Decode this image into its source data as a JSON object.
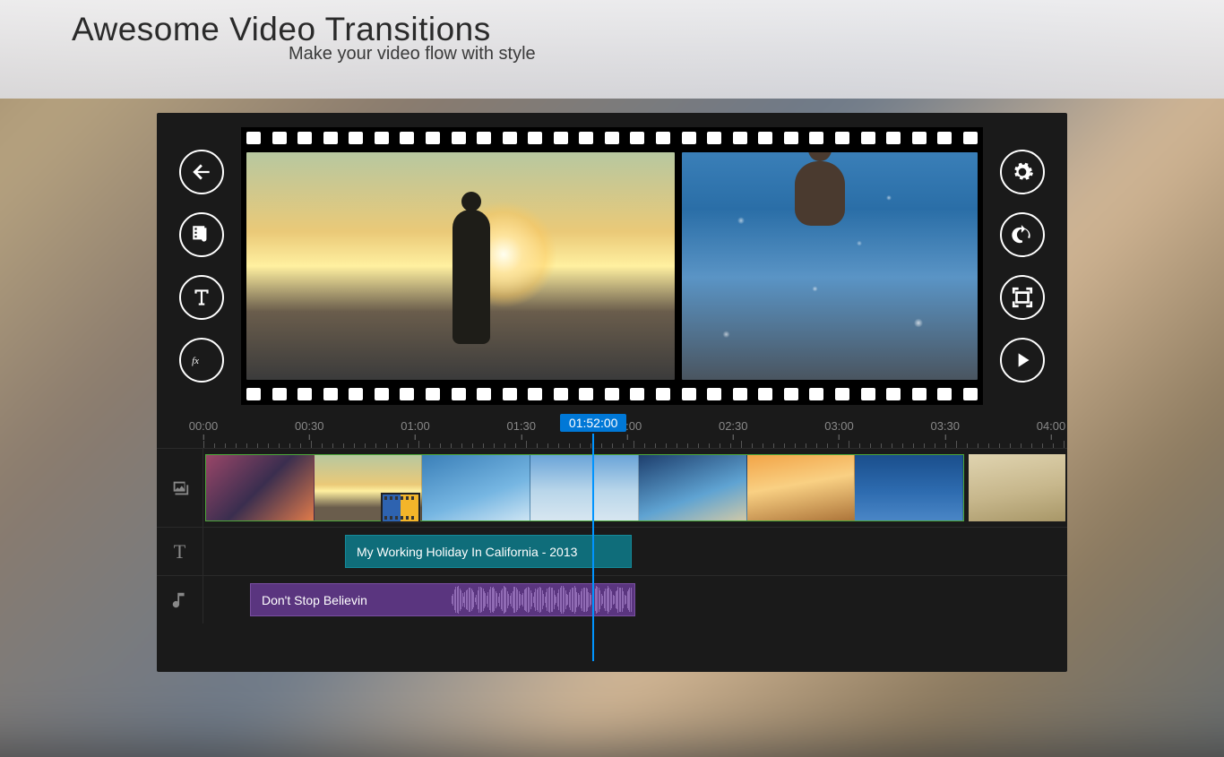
{
  "header": {
    "title": "Awesome Video Transitions",
    "subtitle": "Make your video flow with style"
  },
  "left_tools": {
    "back": "back",
    "media": "media",
    "text": "text",
    "fx": "fx"
  },
  "right_tools": {
    "settings": "settings",
    "undo": "undo",
    "fullscreen": "fullscreen",
    "play": "play"
  },
  "timeline": {
    "ruler_labels": [
      "00:00",
      "00:30",
      "01:00",
      "01:30",
      "02:00",
      "02:30",
      "03:00",
      "03:30",
      "04:00"
    ],
    "playhead": "01:52:00",
    "playhead_position_percent": 46
  },
  "tracks": {
    "video": {
      "icon": "photo-stack",
      "clip_count": 8,
      "transition_applied": true
    },
    "text": {
      "icon": "T",
      "clip_label": "My Working Holiday In California - 2013"
    },
    "audio": {
      "icon": "music-note",
      "clip_label": "Don't Stop Believin"
    }
  }
}
